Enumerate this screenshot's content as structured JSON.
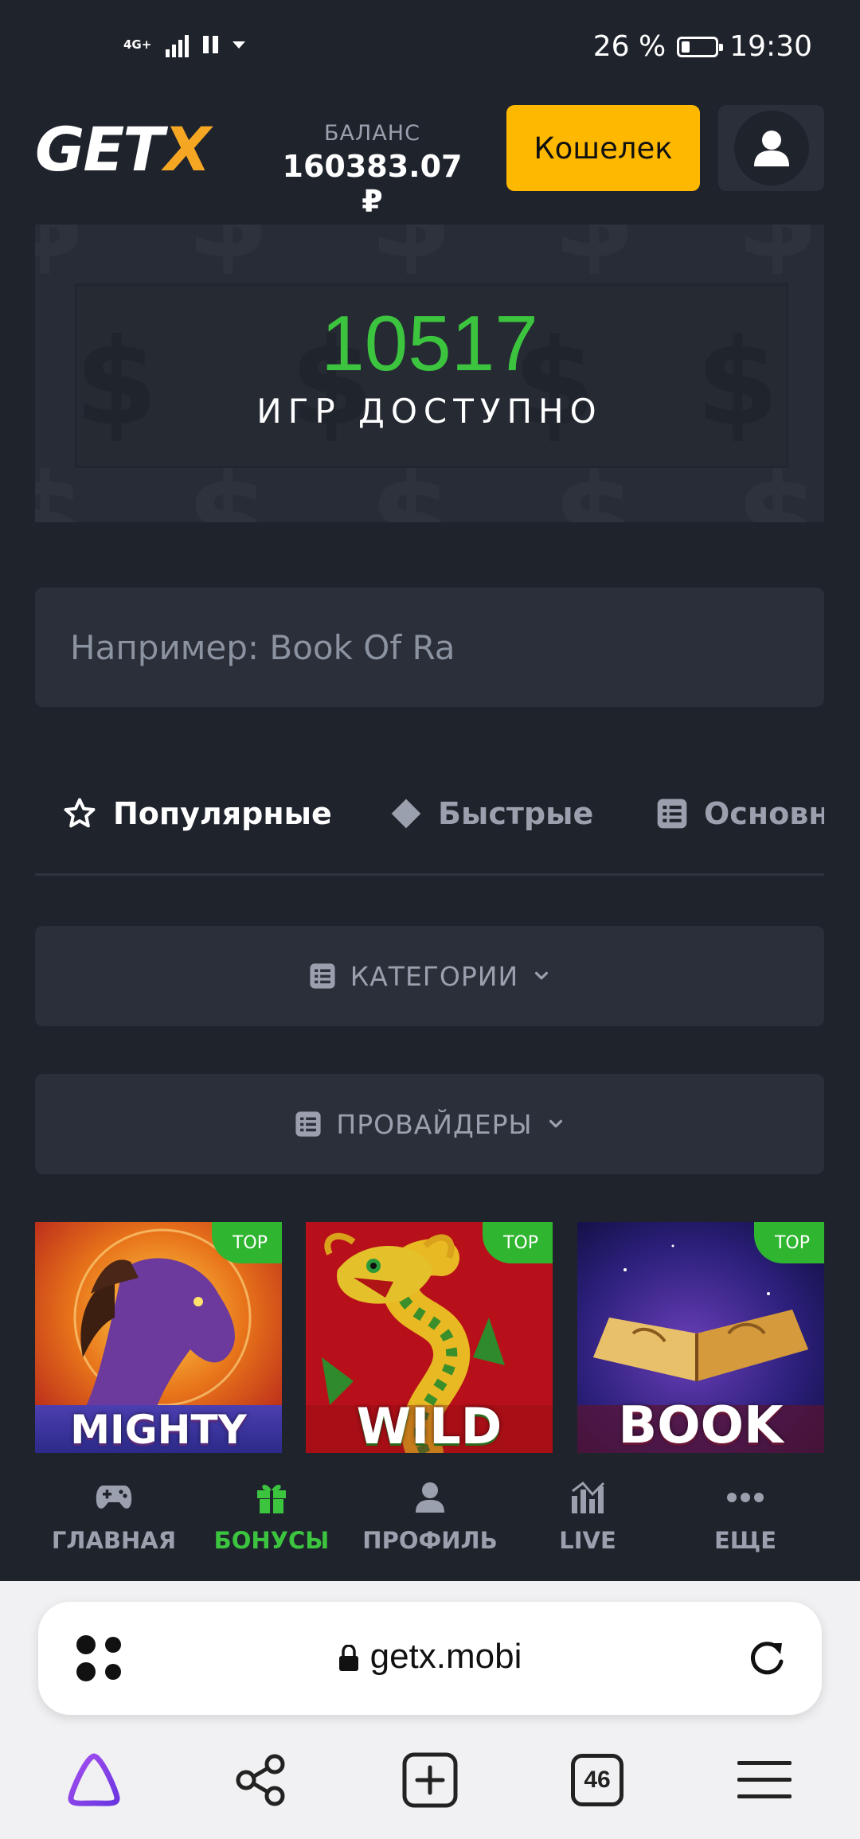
{
  "status_bar": {
    "network": "4G+",
    "battery_percent_text": "26 %",
    "battery_level": 0.26,
    "time": "19:30"
  },
  "header": {
    "logo_main": "GET",
    "logo_accent": "X",
    "balance_label": "БАЛАНС",
    "balance_value": "160383.07 ₽",
    "wallet_button": "Кошелек",
    "profile_icon": "user-icon"
  },
  "banner": {
    "games_count": "10517",
    "games_label": "ИГР ДОСТУПНО"
  },
  "search": {
    "placeholder": "Например: Book Of Ra"
  },
  "tabs": [
    {
      "label": "Популярные",
      "icon": "star-icon",
      "active": true
    },
    {
      "label": "Быстрые",
      "icon": "diamond-icon",
      "active": false
    },
    {
      "label": "Основн",
      "icon": "list-icon",
      "active": false
    }
  ],
  "filters": {
    "categories": "КАТЕГОРИИ",
    "providers": "ПРОВАЙДЕРЫ"
  },
  "games": [
    {
      "title": "MIGHTY",
      "badge": "TOP"
    },
    {
      "title": "WILD",
      "badge": "TOP"
    },
    {
      "title": "BOOK",
      "badge": "TOP"
    }
  ],
  "site_nav": [
    {
      "label": "ГЛАВНАЯ",
      "icon": "gamepad-icon"
    },
    {
      "label": "БОНУСЫ",
      "icon": "gift-icon",
      "active": true
    },
    {
      "label": "ПРОФИЛЬ",
      "icon": "user-icon"
    },
    {
      "label": "LIVE",
      "icon": "chart-icon"
    },
    {
      "label": "ЕЩЕ",
      "icon": "more-dots-icon"
    }
  ],
  "browser": {
    "url": "getx.mobi",
    "tabs_count": "46"
  },
  "colors": {
    "background": "#1f232c",
    "accent_yellow": "#ffb800",
    "accent_green": "#3cc43f",
    "panel": "#2a2f3a"
  }
}
